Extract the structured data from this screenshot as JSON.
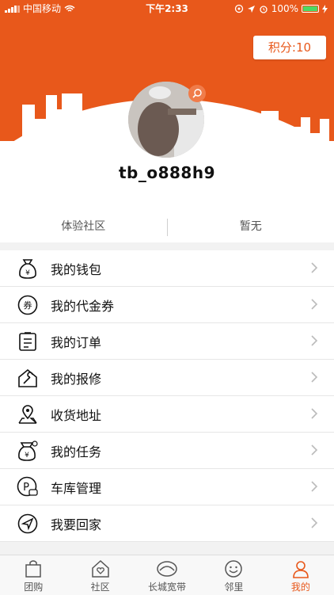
{
  "status_bar": {
    "carrier": "中国移动",
    "time": "下午2:33",
    "battery": "100%",
    "battery_level": 1.0
  },
  "profile": {
    "points_label": "积分:10",
    "username": "tb_o888h9"
  },
  "stats": {
    "community": "体验社区",
    "other": "暂无"
  },
  "menu": [
    {
      "label": "我的钱包",
      "icon": "wallet-icon"
    },
    {
      "label": "我的代金券",
      "icon": "voucher-icon"
    },
    {
      "label": "我的订单",
      "icon": "order-icon"
    },
    {
      "label": "我的报修",
      "icon": "repair-icon"
    },
    {
      "label": "收货地址",
      "icon": "location-icon"
    },
    {
      "label": "我的任务",
      "icon": "task-icon"
    },
    {
      "label": "车库管理",
      "icon": "parking-icon"
    },
    {
      "label": "我要回家",
      "icon": "navigate-icon"
    }
  ],
  "tabs": [
    {
      "label": "团购",
      "icon": "shopping-bag-icon"
    },
    {
      "label": "社区",
      "icon": "home-heart-icon"
    },
    {
      "label": "长城宽带",
      "icon": "broadband-logo-icon"
    },
    {
      "label": "邻里",
      "icon": "smile-icon"
    },
    {
      "label": "我的",
      "icon": "user-icon"
    }
  ],
  "colors": {
    "accent": "#e8581b",
    "battery": "#4cd964"
  }
}
